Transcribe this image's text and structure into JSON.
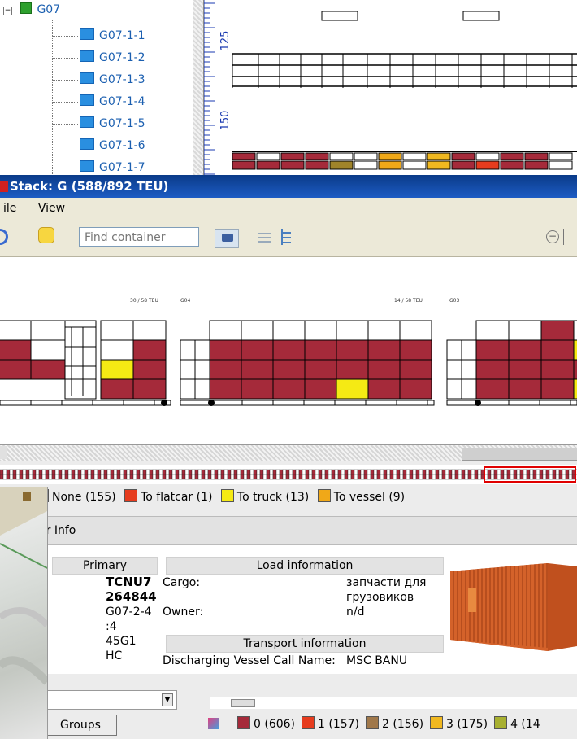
{
  "tree": {
    "root_label": "G07",
    "items": [
      "G07-1-1",
      "G07-1-2",
      "G07-1-3",
      "G07-1-4",
      "G07-1-5",
      "G07-1-6",
      "G07-1-7"
    ]
  },
  "ruler": {
    "labels": [
      "125",
      "150"
    ]
  },
  "window": {
    "title": "Stack: G (588/892 TEU)"
  },
  "menu": {
    "items": [
      "ile",
      "View"
    ]
  },
  "toolbar": {
    "find_placeholder": "Find container"
  },
  "stacks": {
    "labels": [
      "30 / 58 TEU",
      "G04",
      "14 / 58 TEU",
      "G03"
    ]
  },
  "legend": {
    "items": [
      {
        "label": "None (155)",
        "color": "#a52a3a"
      },
      {
        "label": "To flatcar (1)",
        "color": "#e63c1e"
      },
      {
        "label": "To truck (13)",
        "color": "#f5ea14"
      },
      {
        "label": "To vessel (9)",
        "color": "#f0a818"
      }
    ]
  },
  "info": {
    "panel_title": "er Info",
    "primary_header": "Primary",
    "load_header": "Load information",
    "transport_header": "Transport information",
    "colon": ":",
    "container_no_1": "TCNU7",
    "container_no_2": "264844",
    "position_1": "G07-2-4",
    "position_2": ":4",
    "iso_1": "45G1",
    "iso_2": "HC",
    "cargo_label": "Cargo:",
    "cargo_value_1": "запчасти для",
    "cargo_value_2": "грузовиков",
    "owner_label": "Owner:",
    "owner_value": "n/d",
    "vessel_label": "Discharging Vessel Call Name:",
    "vessel_value": "MSC BANU"
  },
  "bottom": {
    "groups_button": "Groups",
    "tier_legend": [
      {
        "label": "0 (606)",
        "color": "#a52a3a"
      },
      {
        "label": "1 (157)",
        "color": "#e63c1e"
      },
      {
        "label": "2 (156)",
        "color": "#a0784a"
      },
      {
        "label": "3 (175)",
        "color": "#f0b820"
      },
      {
        "label": "4 (14",
        "color": "#a8b030"
      }
    ]
  }
}
